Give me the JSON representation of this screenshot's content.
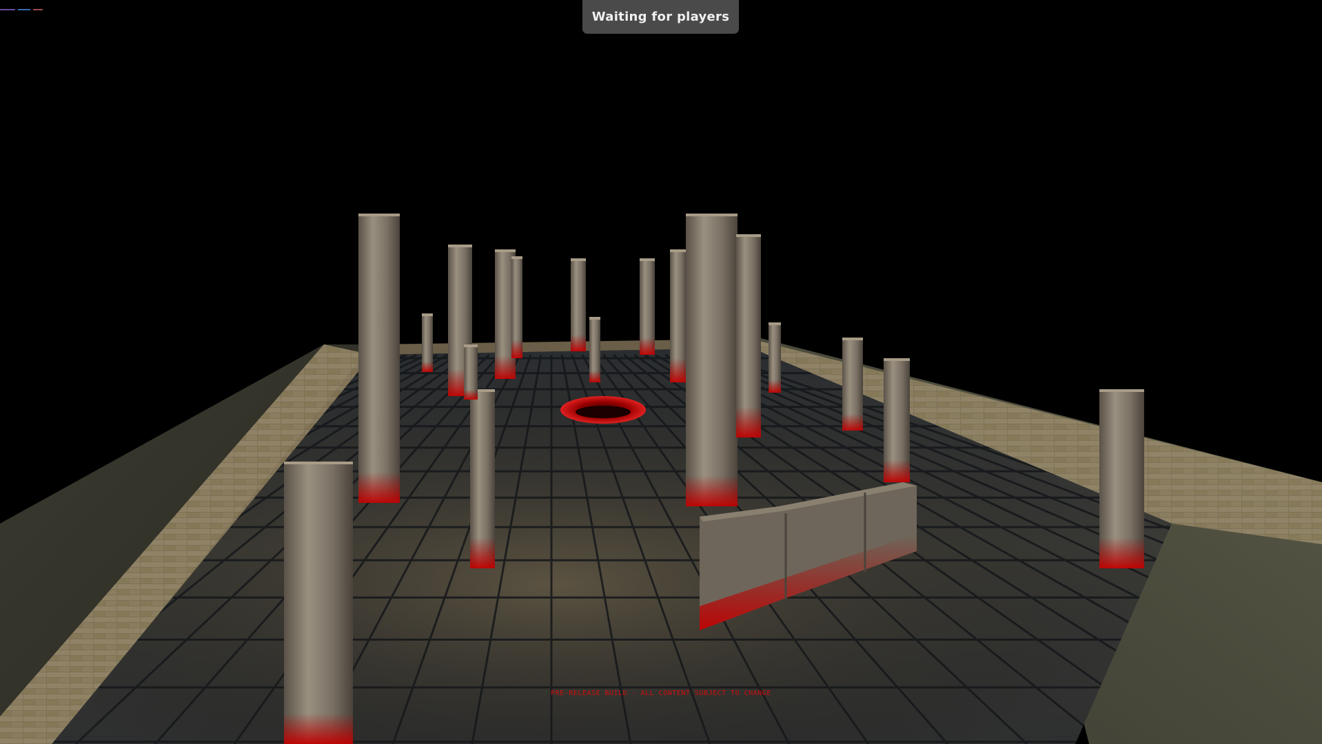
{
  "hud": {
    "status_text": "Waiting for players",
    "build_notice": "PRE-RELEASE BUILD - ALL CONTENT SUBJECT TO CHANGE"
  },
  "colors": {
    "sky": "#000000",
    "status_pill_bg": "#4a4a4a",
    "status_pill_text": "#f0f0f0",
    "build_notice": "#d01010",
    "floor_tile": "#3b3f44",
    "wall_stone": "#8a7a60",
    "pillar_stone": "#7a7468",
    "blood": "#b00000"
  },
  "scene": {
    "name": "arena",
    "objects": [
      "stone-pillars",
      "tiled-floor",
      "perimeter-wall",
      "blood-pit",
      "broken-wall-block"
    ]
  }
}
